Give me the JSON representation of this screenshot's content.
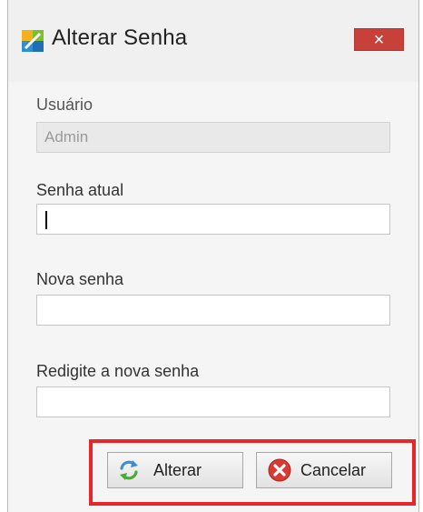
{
  "window": {
    "title": "Alterar Senha",
    "close_glyph": "×"
  },
  "form": {
    "usuario_label": "Usuário",
    "usuario_value": "Admin",
    "senha_atual_label": "Senha atual",
    "senha_atual_value": "",
    "nova_senha_label": "Nova senha",
    "nova_senha_value": "",
    "redigite_label": "Redigite a nova senha",
    "redigite_value": ""
  },
  "buttons": {
    "alterar_label": "Alterar",
    "cancelar_label": "Cancelar"
  },
  "icons": {
    "app": "app-icon",
    "close": "close-icon",
    "alterar": "refresh-icon",
    "cancelar": "cancel-icon"
  },
  "colors": {
    "close_button": "#c8403a",
    "highlight": "#e5262b",
    "disabled_field": "#e9e9e9"
  }
}
